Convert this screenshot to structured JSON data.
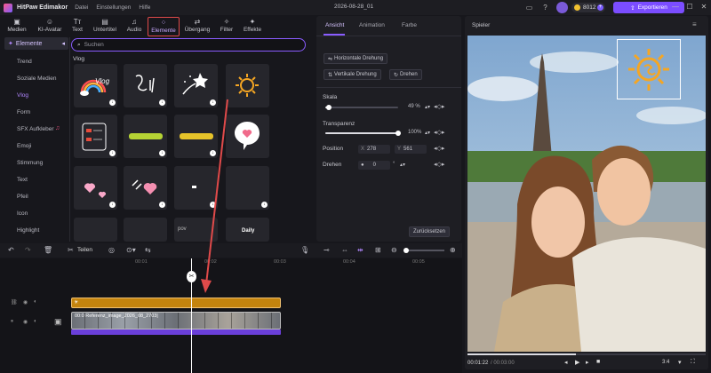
{
  "app": {
    "title": "HitPaw Edimakor",
    "menu": [
      "Datei",
      "Einstellungen",
      "Hilfe"
    ],
    "project": "2026-08-28_01",
    "coins": "8012",
    "export_label": "Exportieren"
  },
  "tools": [
    {
      "label": "Medien",
      "icon": "folder-icon",
      "glyph": "▣"
    },
    {
      "label": "KI-Avatar",
      "icon": "avatar-icon",
      "glyph": "☺"
    },
    {
      "label": "Text",
      "icon": "text-icon",
      "glyph": "Tт"
    },
    {
      "label": "Untertitel",
      "icon": "subtitle-icon",
      "glyph": "▤"
    },
    {
      "label": "Audio",
      "icon": "audio-icon",
      "glyph": "♫"
    },
    {
      "label": "Elemente",
      "icon": "elements-icon",
      "glyph": "⁘"
    },
    {
      "label": "Übergang",
      "icon": "transition-icon",
      "glyph": "⇄"
    },
    {
      "label": "Filter",
      "icon": "filter-icon",
      "glyph": "✧"
    },
    {
      "label": "Effekte",
      "icon": "effects-icon",
      "glyph": "✦"
    }
  ],
  "sidebar": {
    "header": "Elemente",
    "items": [
      "Trend",
      "Soziale Medien",
      "Vlog",
      "Form",
      "SFX Aufkleber",
      "Emoji",
      "Stimmung",
      "Text",
      "Pfeil",
      "Icon",
      "Highlight"
    ],
    "active": "Vlog"
  },
  "library": {
    "search_placeholder": "Suchen",
    "section": "Vlog",
    "tile_texts": {
      "vlog": "Vlog",
      "daily": "Daily",
      "pov": "pov"
    }
  },
  "properties": {
    "tabs": [
      "Ansicht",
      "Animation",
      "Farbe"
    ],
    "active_tab": "Ansicht",
    "flip_h": "Horizontale Drehung",
    "flip_v": "Vertikale Drehung",
    "rotate_btn": "Drehen",
    "scale_label": "Skala",
    "scale_value": "49 %",
    "scale_fraction": 0.05,
    "opacity_label": "Transparenz",
    "opacity_value": "100%",
    "opacity_fraction": 1.0,
    "position_label": "Position",
    "pos_x_label": "X",
    "pos_x": "278",
    "pos_y_label": "Y",
    "pos_y": "561",
    "rotate_label": "Drehen",
    "rotate_value": "0",
    "rotate_unit": "°",
    "reset": "Zurücksetzen"
  },
  "player": {
    "title": "Spieler",
    "current_time": "00:01:22",
    "total_time": "/ 00:03:00",
    "ratio": "3:4"
  },
  "timeline": {
    "split_label": "Teilen",
    "ruler": [
      "00:01",
      "00:02",
      "00:03",
      "00:04",
      "00:05",
      "00:06"
    ],
    "video_clip_label": "00:0 Referenz_image_2026_08_2703|"
  },
  "colors": {
    "accent": "#7b4dff",
    "highlight_border": "#e04a4a",
    "sticker_track": "#c4840e",
    "audio_bar": "#6a3fd9"
  }
}
